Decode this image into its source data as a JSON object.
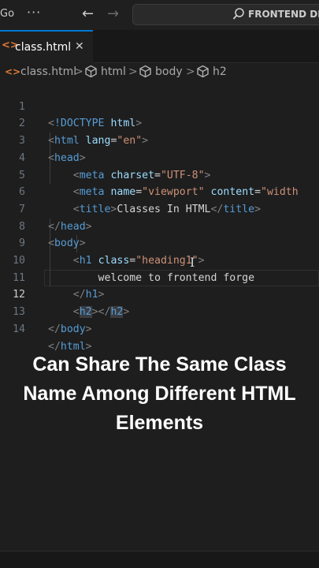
{
  "titlebar": {
    "menu_label": "Go",
    "more_label": "···",
    "back_label": "←",
    "forward_label": "→",
    "search_text": "FRONTEND DE"
  },
  "tab": {
    "filename": "class.html",
    "icon": "<>",
    "close": "✕"
  },
  "breadcrumb": {
    "file": "class.html",
    "items": [
      "html",
      "body",
      "h2"
    ],
    "separator": ">"
  },
  "editor": {
    "active_line": 12,
    "line_numbers": [
      "1",
      "2",
      "3",
      "4",
      "5",
      "6",
      "7",
      "8",
      "9",
      "10",
      "11",
      "12",
      "13",
      "14"
    ]
  },
  "caption": {
    "lines": [
      "Can Share The Same Class",
      "Name Among Different HTML",
      "Elements"
    ]
  },
  "colors": {
    "background": "#1e1e1e",
    "tag": "#569cd6",
    "attribute": "#9cdcfe",
    "string": "#ce9178",
    "accent": "#0078d4",
    "html_icon": "#e37933"
  }
}
